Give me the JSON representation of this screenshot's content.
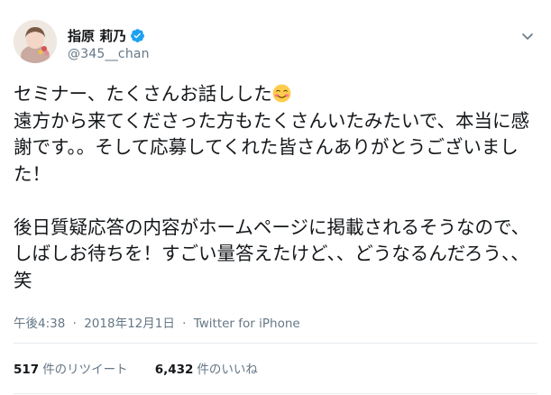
{
  "user": {
    "display_name": "指原 莉乃",
    "handle": "@345__chan"
  },
  "tweet": {
    "paragraph1_text": "セミナー、たくさんお話しした",
    "paragraph1_emoji": "smiling-face-with-blush-emoji",
    "paragraph1_rest": "\n遠方から来てくださった方もたくさんいたみたいで、本当に感謝です。。そして応募してくれた皆さんありがとうございました！",
    "paragraph2": "後日質疑応答の内容がホームページに掲載されるそうなので、しばしお待ちを！すごい量答えたけど、、どうなるんだろう、、笑"
  },
  "meta": {
    "time": "午後4:38",
    "separator": "·",
    "date": "2018年12月1日",
    "source": "Twitter for iPhone"
  },
  "stats": {
    "retweets_count": "517",
    "retweets_label": "件のリツイート",
    "likes_count": "6,432",
    "likes_label": "件のいいね"
  },
  "colors": {
    "verified": "#1da1f2",
    "text": "#14171a",
    "secondary": "#657786",
    "divider": "#e6ecf0"
  },
  "icons": {
    "verified": "verified-badge-icon",
    "chevron": "chevron-down-icon"
  }
}
